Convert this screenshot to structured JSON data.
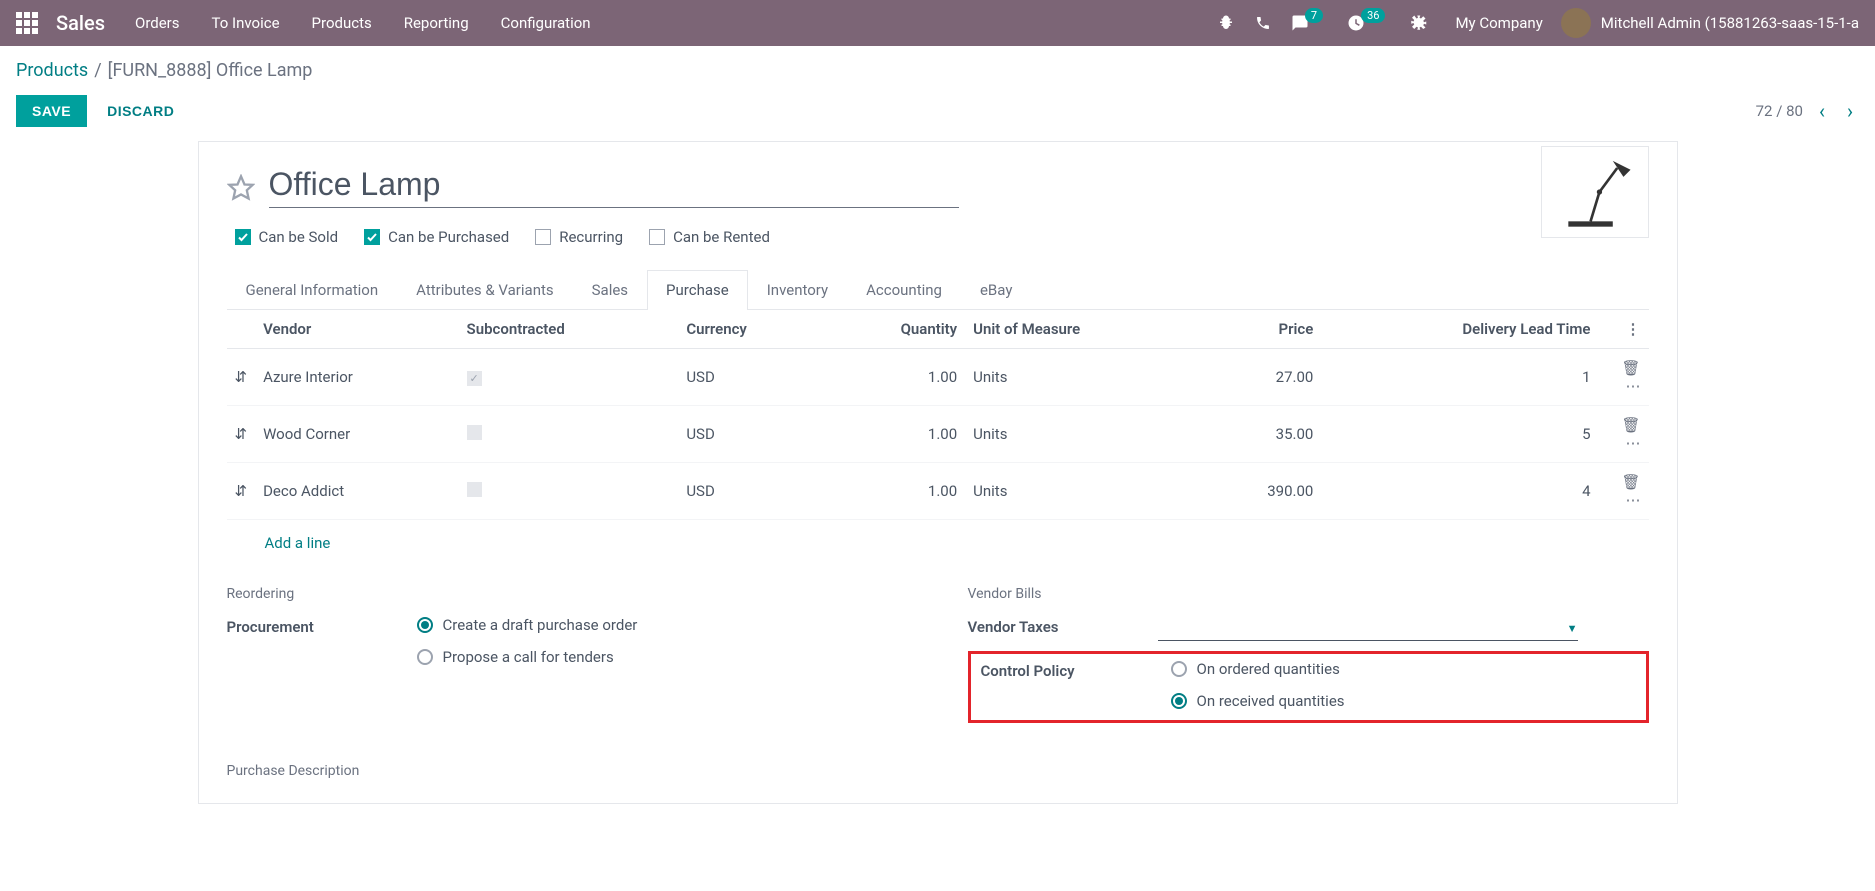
{
  "navbar": {
    "brand": "Sales",
    "menu": [
      "Orders",
      "To Invoice",
      "Products",
      "Reporting",
      "Configuration"
    ],
    "messages_badge": "7",
    "activities_badge": "36",
    "company": "My Company",
    "user": "Mitchell Admin (15881263-saas-15-1-a"
  },
  "breadcrumb": {
    "parent": "Products",
    "current": "[FURN_8888] Office Lamp"
  },
  "actions": {
    "save": "SAVE",
    "discard": "DISCARD",
    "pager": "72 / 80"
  },
  "product": {
    "name": "Office Lamp",
    "checkboxes": {
      "can_be_sold": {
        "label": "Can be Sold",
        "checked": true
      },
      "can_be_purchased": {
        "label": "Can be Purchased",
        "checked": true
      },
      "recurring": {
        "label": "Recurring",
        "checked": false
      },
      "can_be_rented": {
        "label": "Can be Rented",
        "checked": false
      }
    }
  },
  "tabs": [
    "General Information",
    "Attributes & Variants",
    "Sales",
    "Purchase",
    "Inventory",
    "Accounting",
    "eBay"
  ],
  "active_tab": "Purchase",
  "vendor_table": {
    "headers": {
      "vendor": "Vendor",
      "subcontracted": "Subcontracted",
      "currency": "Currency",
      "quantity": "Quantity",
      "uom": "Unit of Measure",
      "price": "Price",
      "lead_time": "Delivery Lead Time"
    },
    "rows": [
      {
        "vendor": "Azure Interior",
        "subcontracted": true,
        "currency": "USD",
        "quantity": "1.00",
        "uom": "Units",
        "price": "27.00",
        "lead_time": "1"
      },
      {
        "vendor": "Wood Corner",
        "subcontracted": false,
        "currency": "USD",
        "quantity": "1.00",
        "uom": "Units",
        "price": "35.00",
        "lead_time": "5"
      },
      {
        "vendor": "Deco Addict",
        "subcontracted": false,
        "currency": "USD",
        "quantity": "1.00",
        "uom": "Units",
        "price": "390.00",
        "lead_time": "4"
      }
    ],
    "add_line": "Add a line"
  },
  "reordering": {
    "title": "Reordering",
    "procurement_label": "Procurement",
    "option_draft": "Create a draft purchase order",
    "option_tenders": "Propose a call for tenders"
  },
  "vendor_bills": {
    "title": "Vendor Bills",
    "vendor_taxes_label": "Vendor Taxes",
    "control_policy_label": "Control Policy",
    "option_ordered": "On ordered quantities",
    "option_received": "On received quantities"
  },
  "purchase_description_title": "Purchase Description"
}
